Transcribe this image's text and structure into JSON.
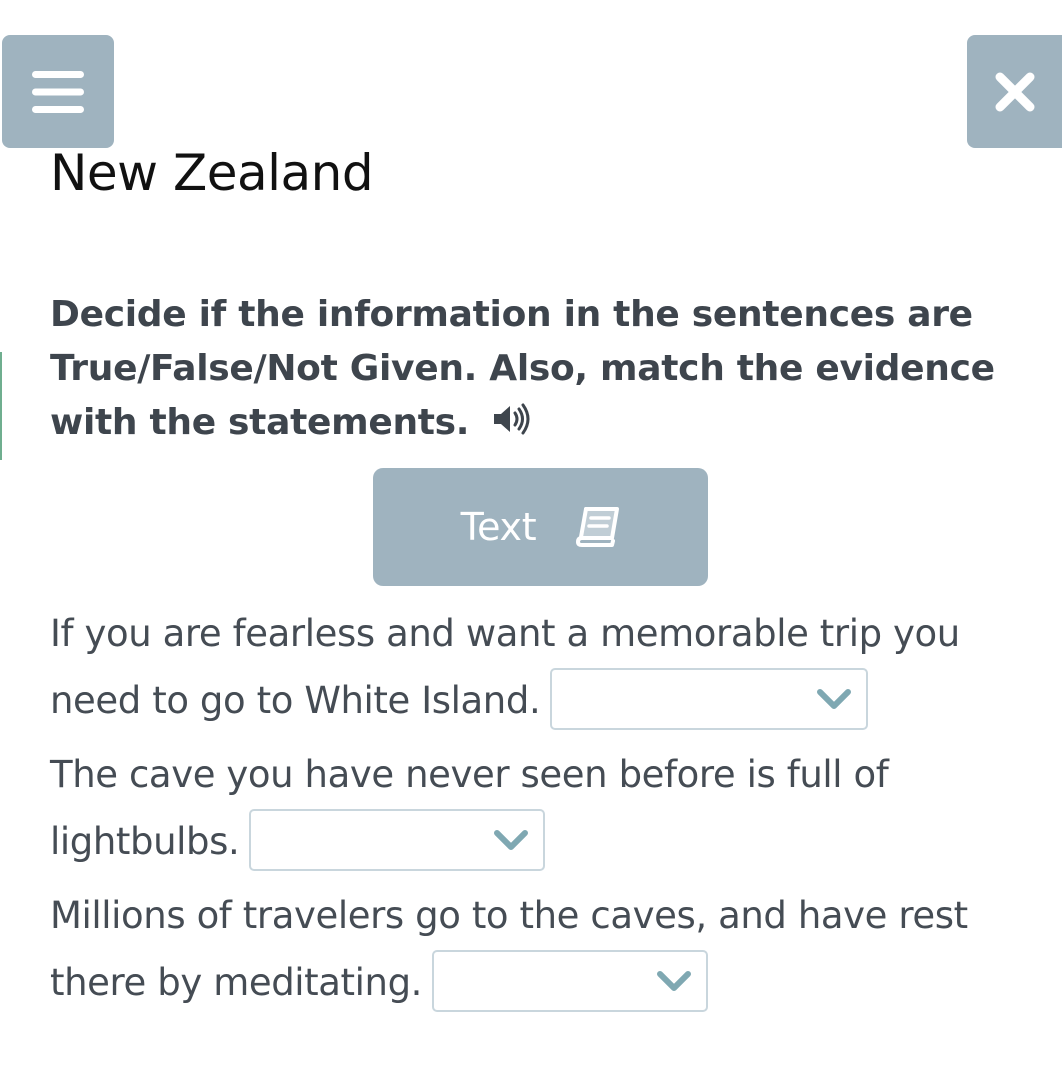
{
  "header": {
    "title": "New Zealand",
    "menu_icon": "hamburger-icon",
    "close_icon": "close-icon"
  },
  "instructions": {
    "text": "Decide if the information in the sentences are True/False/Not Given. Also, match the evidence with the statements.",
    "audio_icon": "speaker-icon"
  },
  "text_button": {
    "label": "Text",
    "icon": "book-icon"
  },
  "questions": [
    {
      "text": "If you are fearless and want a memorable trip you need to go to White Island.",
      "selected": ""
    },
    {
      "text": "The cave you have never seen before is full of lightbulbs.",
      "selected": ""
    },
    {
      "text": "Millions of travelers go to the caves, and have rest there by meditating.",
      "selected": ""
    }
  ],
  "colors": {
    "button_bg": "#9fb3bf",
    "text": "#424a52",
    "title": "#111111",
    "select_border": "#c9d6dd",
    "chevron": "#7fa8b2",
    "accent": "#6fae8f"
  }
}
